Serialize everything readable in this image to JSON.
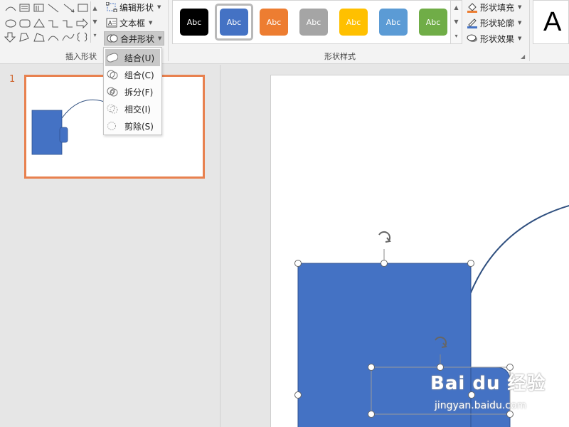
{
  "ribbon": {
    "insert_shapes_group": {
      "label": "插入形状",
      "edit_shape_label": "编辑形状",
      "text_box_label": "文本框",
      "merge_shapes_label": "合并形状"
    },
    "shape_styles_group": {
      "label": "形状样式",
      "swatches": [
        {
          "label": "Abc",
          "color": "#000000"
        },
        {
          "label": "Abc",
          "color": "#4472C4"
        },
        {
          "label": "Abc",
          "color": "#ED7D31"
        },
        {
          "label": "Abc",
          "color": "#A5A5A5"
        },
        {
          "label": "Abc",
          "color": "#FFC000"
        },
        {
          "label": "Abc",
          "color": "#5B9BD5"
        },
        {
          "label": "Abc",
          "color": "#70AD47"
        }
      ],
      "fill_label": "形状填充",
      "outline_label": "形状轮廓",
      "effects_label": "形状效果"
    },
    "wordart_sample": "A"
  },
  "merge_menu": {
    "items": [
      {
        "label": "结合(U)",
        "icon": "union-icon"
      },
      {
        "label": "组合(C)",
        "icon": "combine-icon"
      },
      {
        "label": "拆分(F)",
        "icon": "fragment-icon"
      },
      {
        "label": "相交(I)",
        "icon": "intersect-icon"
      },
      {
        "label": "剪除(S)",
        "icon": "subtract-icon"
      }
    ]
  },
  "thumbnail_pane": {
    "slide_number": "1"
  },
  "watermark": {
    "logo": "Bai du 经验",
    "url": "jingyan.baidu.com"
  },
  "colors": {
    "shape_fill": "#4472C4",
    "shape_stroke": "#2F528F",
    "arc_stroke": "#2F4F7F",
    "thumb_border": "#E8814F",
    "accent_orange": "#D06A35"
  }
}
